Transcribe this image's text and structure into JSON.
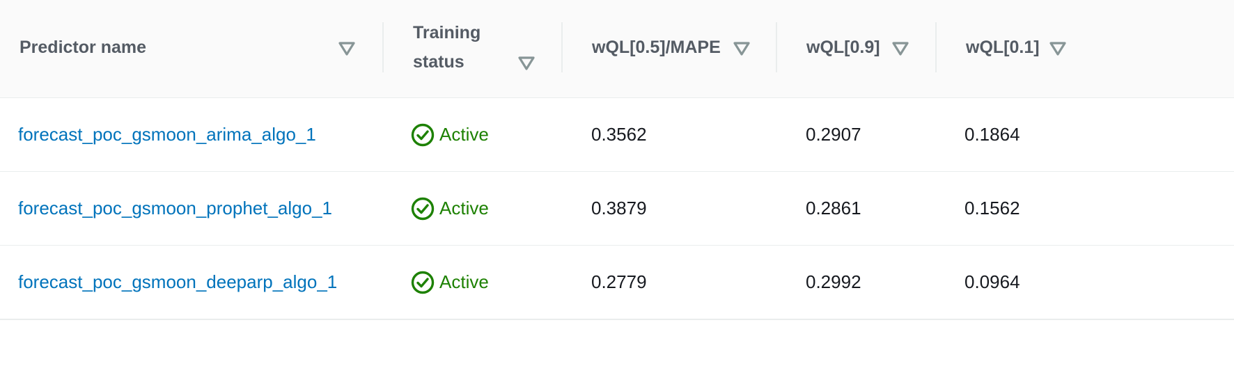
{
  "columns": {
    "name": "Predictor name",
    "training_line1": "Training",
    "training_line2": "status",
    "wql05": "wQL[0.5]/MAPE",
    "wql09": "wQL[0.9]",
    "wql01": "wQL[0.1]"
  },
  "status_color": "#1d8102",
  "link_color": "#0073bb",
  "rows": [
    {
      "name": "forecast_poc_gsmoon_arima_algo_1",
      "status": "Active",
      "wql05": "0.3562",
      "wql09": "0.2907",
      "wql01": "0.1864"
    },
    {
      "name": "forecast_poc_gsmoon_prophet_algo_1",
      "status": "Active",
      "wql05": "0.3879",
      "wql09": "0.2861",
      "wql01": "0.1562"
    },
    {
      "name": "forecast_poc_gsmoon_deeparp_algo_1",
      "status": "Active",
      "wql05": "0.2779",
      "wql09": "0.2992",
      "wql01": "0.0964"
    }
  ]
}
